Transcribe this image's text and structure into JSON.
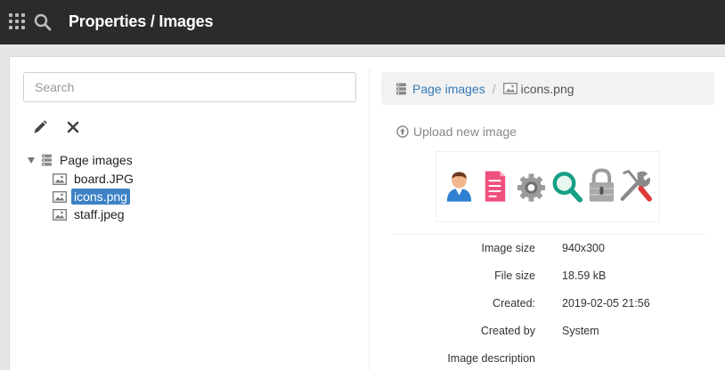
{
  "header": {
    "title": "Properties / Images"
  },
  "search": {
    "placeholder": "Search",
    "value": ""
  },
  "tree": {
    "root": {
      "label": "Page images",
      "icon": "server-icon",
      "expanded": true
    },
    "children": [
      {
        "label": "board.JPG",
        "selected": false
      },
      {
        "label": "icons.png",
        "selected": true
      },
      {
        "label": "staff.jpeg",
        "selected": false
      }
    ]
  },
  "breadcrumb": {
    "root": "Page images",
    "separator": "/",
    "current": "icons.png"
  },
  "upload": {
    "label": "Upload new image"
  },
  "preview_icons": [
    "user-icon",
    "document-icon",
    "gear-icon",
    "magnifier-icon",
    "lock-icon",
    "tools-icon"
  ],
  "details": [
    {
      "label": "Image size",
      "value": "940x300"
    },
    {
      "label": "File size",
      "value": "18.59 kB"
    },
    {
      "label": "Created:",
      "value": "2019-02-05 21:56"
    },
    {
      "label": "Created by",
      "value": "System"
    },
    {
      "label": "Image description",
      "value": ""
    }
  ],
  "colors": {
    "topbar": "#2b2b2b",
    "link": "#337ab7",
    "selection": "#3d82c6"
  }
}
